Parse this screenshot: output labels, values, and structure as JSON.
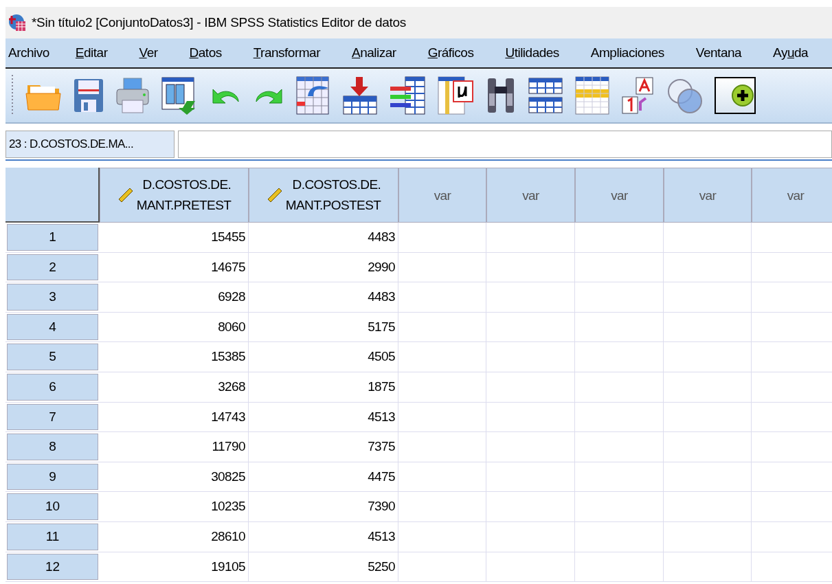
{
  "window": {
    "title": "*Sin título2 [ConjuntoDatos3] - IBM SPSS Statistics Editor de datos"
  },
  "menu": [
    {
      "after": "Archivo"
    },
    {
      "key": "E",
      "after": "ditar"
    },
    {
      "key": "V",
      "after": "er"
    },
    {
      "key": "D",
      "after": "atos"
    },
    {
      "key": "T",
      "after": "ransformar"
    },
    {
      "key": "A",
      "after": "nalizar"
    },
    {
      "key": "G",
      "after": "ráficos"
    },
    {
      "key": "U",
      "after": "tilidades"
    },
    {
      "after": "Ampliaciones"
    },
    {
      "after": "Ventana"
    },
    {
      "before": "Ay",
      "key": "u",
      "after": "da"
    }
  ],
  "cell_reference": "23 : D.COSTOS.DE.MA...",
  "table": {
    "columns": [
      {
        "label": "D.COSTOS.DE.\nMANT.PRETEST",
        "kind": "scale"
      },
      {
        "label": "D.COSTOS.DE.\nMANT.POSTEST",
        "kind": "scale"
      },
      {
        "label": "var",
        "kind": "empty"
      },
      {
        "label": "var",
        "kind": "empty"
      },
      {
        "label": "var",
        "kind": "empty"
      },
      {
        "label": "var",
        "kind": "empty"
      },
      {
        "label": "var",
        "kind": "empty"
      }
    ],
    "rows": [
      {
        "number": "1",
        "cells": [
          "15455",
          "4483"
        ]
      },
      {
        "number": "2",
        "cells": [
          "14675",
          "2990"
        ]
      },
      {
        "number": "3",
        "cells": [
          "6928",
          "4483"
        ]
      },
      {
        "number": "4",
        "cells": [
          "8060",
          "5175"
        ]
      },
      {
        "number": "5",
        "cells": [
          "15385",
          "4505"
        ]
      },
      {
        "number": "6",
        "cells": [
          "3268",
          "1875"
        ]
      },
      {
        "number": "7",
        "cells": [
          "14743",
          "4513"
        ]
      },
      {
        "number": "8",
        "cells": [
          "11790",
          "7375"
        ]
      },
      {
        "number": "9",
        "cells": [
          "30825",
          "4475"
        ]
      },
      {
        "number": "10",
        "cells": [
          "10235",
          "7390"
        ]
      },
      {
        "number": "11",
        "cells": [
          "28610",
          "4513"
        ]
      },
      {
        "number": "12",
        "cells": [
          "19105",
          "5250"
        ]
      }
    ]
  }
}
